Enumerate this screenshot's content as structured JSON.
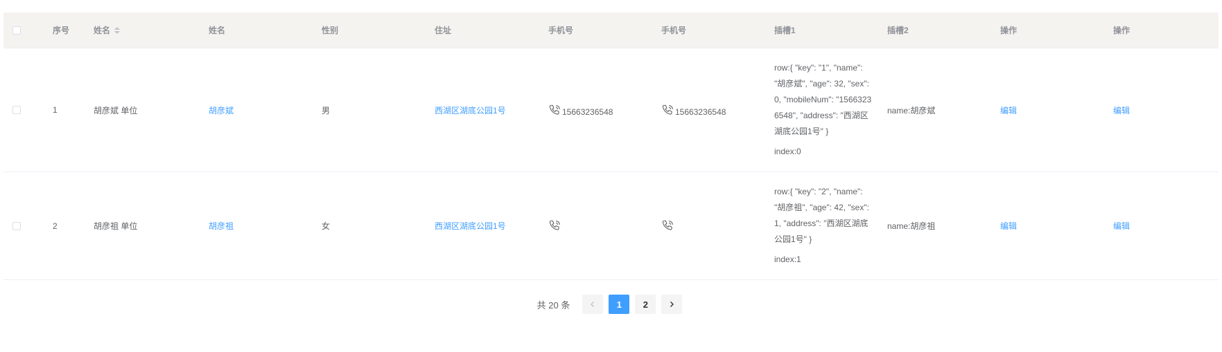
{
  "header": {
    "index": "序号",
    "name": "姓名",
    "name2": "姓名",
    "sex": "性别",
    "address": "住址",
    "phone1": "手机号",
    "phone2": "手机号",
    "slot1": "插槽1",
    "slot2": "插槽2",
    "op1": "操作",
    "op2": "操作"
  },
  "rows": [
    {
      "index": "1",
      "name_unit": "胡彦斌 单位",
      "name_link": "胡彦斌",
      "sex": "男",
      "address": "西湖区湖底公园1号",
      "phone1": "15663236548",
      "phone2": "15663236548",
      "slot1_row": "row:{ \"key\": \"1\", \"name\": \"胡彦斌\", \"age\": 32, \"sex\": 0, \"mobileNum\": \"15663236548\", \"address\": \"西湖区湖底公园1号\" }",
      "slot1_index": "index:0",
      "slot2": "name:胡彦斌",
      "op1": "编辑",
      "op2": "编辑"
    },
    {
      "index": "2",
      "name_unit": "胡彦祖 单位",
      "name_link": "胡彦祖",
      "sex": "女",
      "address": "西湖区湖底公园1号",
      "phone1": "",
      "phone2": "",
      "slot1_row": "row:{ \"key\": \"2\", \"name\": \"胡彦祖\", \"age\": 42, \"sex\": 1, \"address\": \"西湖区湖底公园1号\" }",
      "slot1_index": "index:1",
      "slot2": "name:胡彦祖",
      "op1": "编辑",
      "op2": "编辑"
    }
  ],
  "pagination": {
    "total_label": "共 20 条",
    "pages": [
      "1",
      "2"
    ],
    "current": "1",
    "prev_icon": "chevron-left-icon",
    "next_icon": "chevron-right-icon"
  },
  "colors": {
    "accent": "#409eff",
    "header_bg": "#f5f3f0"
  },
  "icons": {
    "phone": "phone-icon",
    "sort": "sort-caret-icon"
  }
}
